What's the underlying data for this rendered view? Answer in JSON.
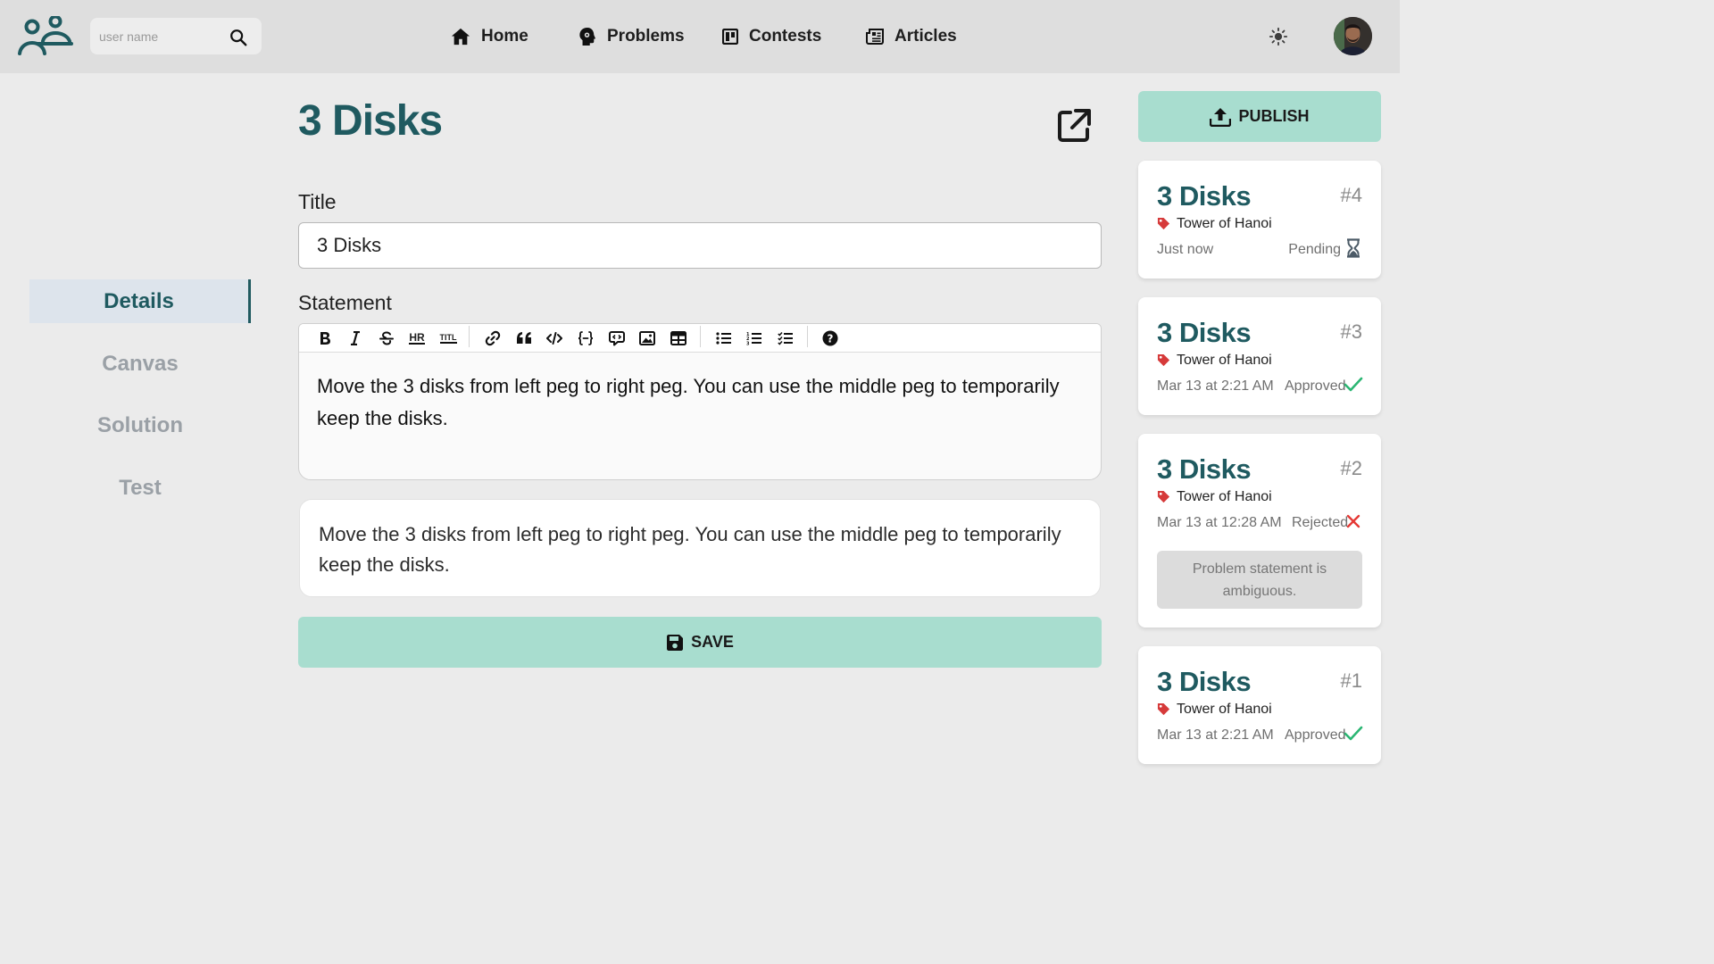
{
  "header": {
    "search": {
      "placeholder": "user name"
    },
    "nav": [
      {
        "label": "Home",
        "icon": "home-icon"
      },
      {
        "label": "Problems",
        "icon": "brain-icon"
      },
      {
        "label": "Contests",
        "icon": "board-icon"
      },
      {
        "label": "Articles",
        "icon": "newspaper-icon"
      }
    ],
    "theme_icon": "sun-icon",
    "avatar_icon": "user-avatar"
  },
  "sidebar": {
    "tabs": [
      {
        "label": "Details",
        "active": true
      },
      {
        "label": "Canvas",
        "active": false
      },
      {
        "label": "Solution",
        "active": false
      },
      {
        "label": "Test",
        "active": false
      }
    ]
  },
  "main": {
    "heading": "3 Disks",
    "title_label": "Title",
    "title_value": "3 Disks",
    "statement_label": "Statement",
    "statement_text": "Move the 3 disks from left peg to right peg. You can use the middle peg to temporarily keep the disks.",
    "preview_text": "Move the 3 disks from left peg to right peg. You can use the middle peg to temporarily keep the disks.",
    "toolbar": [
      "bold",
      "italic",
      "strikethrough",
      "hr",
      "title",
      "link",
      "quote",
      "code",
      "code-block",
      "comment",
      "image",
      "table",
      "unordered-list",
      "ordered-list",
      "checked-list",
      "help"
    ],
    "toolbar_labels": {
      "hr": "HR",
      "title": "TITL"
    },
    "save_label": "SAVE"
  },
  "submissions": {
    "publish_label": "PUBLISH",
    "items": [
      {
        "title": "3 Disks",
        "number": "#4",
        "tag": "Tower of Hanoi",
        "time": "Just now",
        "status": "Pending",
        "status_icon": "hourglass-icon",
        "status_color": "#4c5b67"
      },
      {
        "title": "3 Disks",
        "number": "#3",
        "tag": "Tower of Hanoi",
        "time": "Mar 13 at 2:21 AM",
        "status": "Approved",
        "status_icon": "check-icon",
        "status_color": "#2bb673"
      },
      {
        "title": "3 Disks",
        "number": "#2",
        "tag": "Tower of Hanoi",
        "time": "Mar 13 at 12:28 AM",
        "status": "Rejected",
        "status_icon": "x-icon",
        "status_color": "#e53935",
        "comment": "Problem statement is ambiguous."
      },
      {
        "title": "3 Disks",
        "number": "#1",
        "tag": "Tower of Hanoi",
        "time": "Mar 13 at 2:21 AM",
        "status": "Approved",
        "status_icon": "check-icon",
        "status_color": "#2bb673"
      }
    ]
  },
  "colors": {
    "accent": "#1f5a60",
    "button": "#a8ddcf",
    "tag": "#d63a3a"
  }
}
